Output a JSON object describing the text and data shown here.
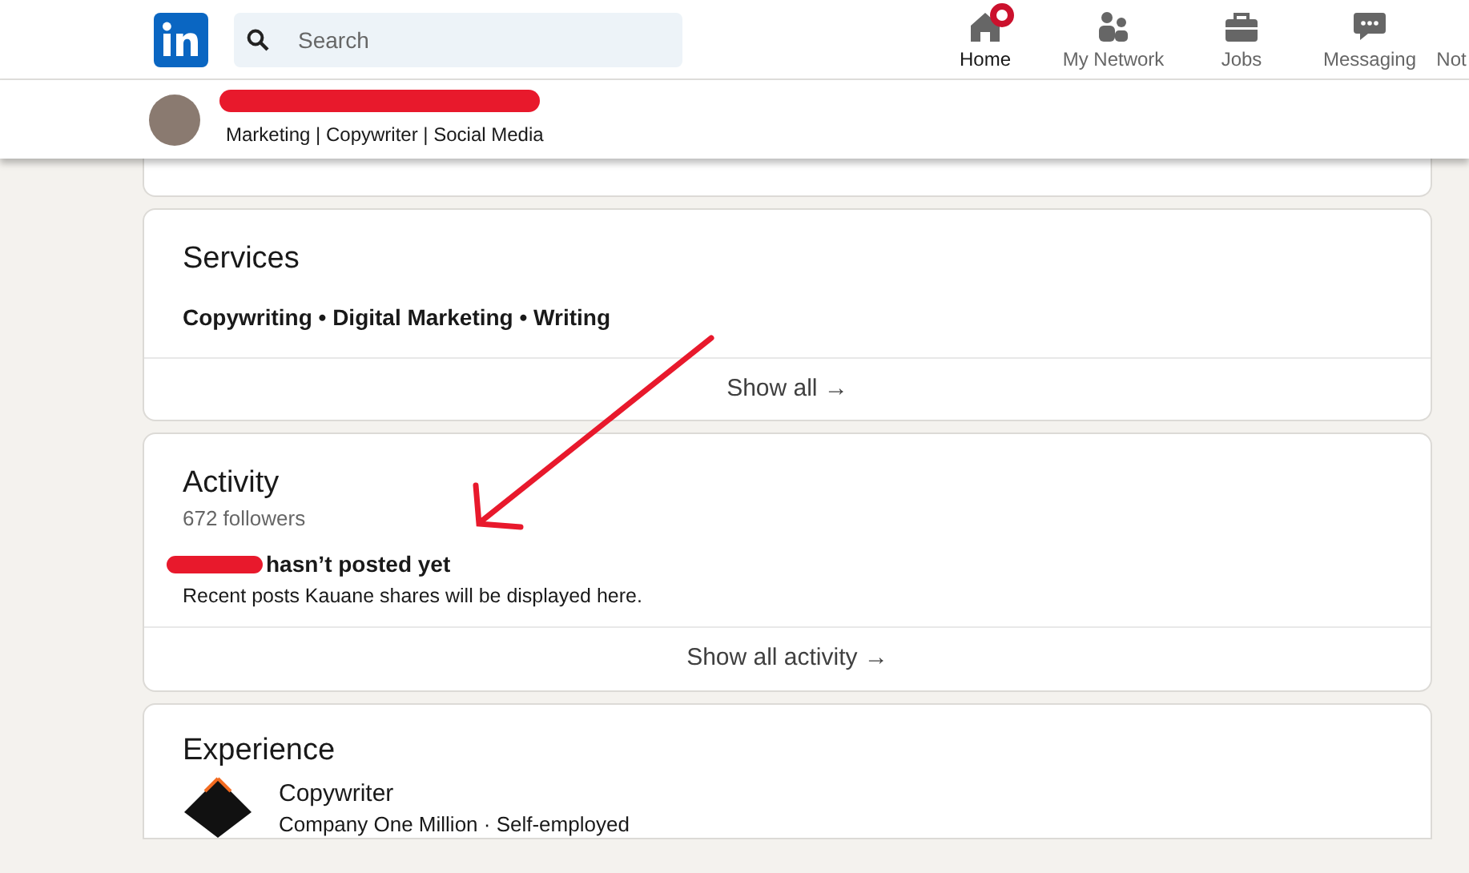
{
  "search": {
    "placeholder": "Search"
  },
  "nav": [
    {
      "label": "Home",
      "kind": "home",
      "selected": true,
      "notification": true
    },
    {
      "label": "My Network",
      "kind": "network",
      "selected": false,
      "notification": false
    },
    {
      "label": "Jobs",
      "kind": "jobs",
      "selected": false,
      "notification": false
    },
    {
      "label": "Messaging",
      "kind": "messaging",
      "selected": false,
      "notification": false
    },
    {
      "label": "Not",
      "kind": "none",
      "selected": false,
      "notification": false
    }
  ],
  "profile_bar": {
    "headline": "Marketing | Copywriter | Social Media"
  },
  "services": {
    "title": "Services",
    "items": "Copywriting • Digital Marketing • Writing",
    "footer_link": "Show all →"
  },
  "activity": {
    "title": "Activity",
    "followers": "672 followers",
    "empty_title": "hasn’t posted yet",
    "empty_text": "Recent posts Kauane shares will be displayed here.",
    "footer_link": "Show all activity →"
  },
  "experience": {
    "title": "Experience",
    "entries": [
      {
        "role": "Copywriter",
        "company": "Company One Million · Self-employed"
      }
    ]
  }
}
